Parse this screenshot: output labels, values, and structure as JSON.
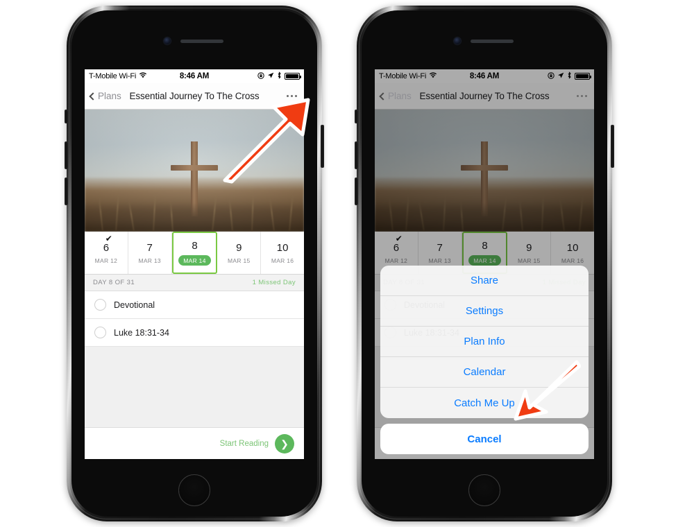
{
  "background_color": "#ffffff",
  "accent_green": "#5cb85c",
  "accent_blue": "#0a7cff",
  "annotation_color": "#f03c12",
  "status_bar": {
    "carrier": "T-Mobile Wi-Fi",
    "wifi_icon": "wifi-icon",
    "time": "8:46 AM",
    "rotation_lock_icon": "rotation-lock-icon",
    "location_icon": "location-arrow-icon",
    "bluetooth_icon": "bluetooth-icon",
    "battery_icon": "battery-full-icon"
  },
  "nav": {
    "back_label": "Plans",
    "back_icon": "chevron-left-icon",
    "title": "Essential Journey To The Cross",
    "more_icon": "more-horizontal-icon"
  },
  "hero": {
    "alt": "wooden cross standing in a field of dry grass at dusk"
  },
  "calendar": {
    "days": [
      {
        "num": "6",
        "date": "MAR 12",
        "selected": false,
        "completed": true
      },
      {
        "num": "7",
        "date": "MAR 13",
        "selected": false,
        "completed": false
      },
      {
        "num": "8",
        "date": "MAR 14",
        "selected": true,
        "completed": false
      },
      {
        "num": "9",
        "date": "MAR 15",
        "selected": false,
        "completed": false
      },
      {
        "num": "10",
        "date": "MAR 16",
        "selected": false,
        "completed": false
      }
    ],
    "check_glyph": "✔"
  },
  "day_header": {
    "progress": "DAY 8 OF 31",
    "missed": "1 Missed Day"
  },
  "tasks": [
    {
      "label": "Devotional",
      "checked": false
    },
    {
      "label": "Luke 18:31-34",
      "checked": false
    }
  ],
  "bottom_bar": {
    "label": "Start Reading",
    "button_icon": "chevron-right-icon",
    "button_glyph": "❯"
  },
  "action_sheet": {
    "items": [
      {
        "label": "Share"
      },
      {
        "label": "Settings"
      },
      {
        "label": "Plan Info"
      },
      {
        "label": "Calendar"
      },
      {
        "label": "Catch Me Up"
      }
    ],
    "cancel_label": "Cancel"
  },
  "annotations": [
    {
      "name": "arrow-to-more-menu",
      "direction": "up-right",
      "target": "more-horizontal-icon"
    },
    {
      "name": "arrow-to-catch-me-up",
      "direction": "down-left",
      "target": "Catch Me Up"
    }
  ]
}
